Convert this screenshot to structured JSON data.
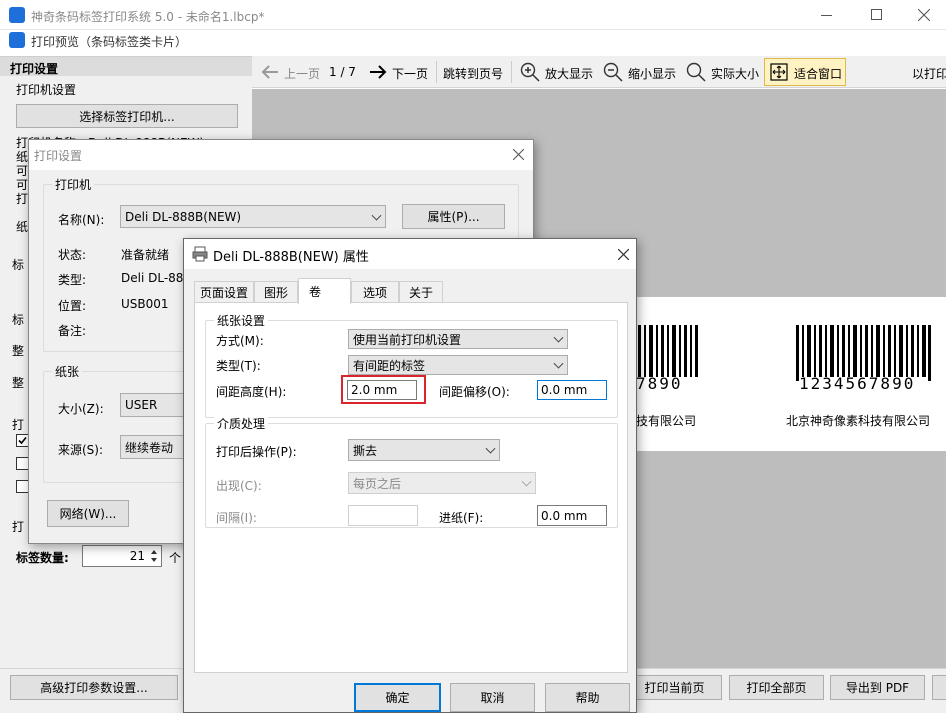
{
  "app": {
    "title": "神奇条码标签打印系统 5.0 - 未命名1.lbcp*"
  },
  "preview_window": {
    "title": "打印预览（条码标签类卡片）"
  },
  "toolbar": {
    "prev_label": "上一页",
    "page_indicator": "1 / 7",
    "next_label": "下一页",
    "jump_label": "跳转到页号",
    "zoom_in_label": "放大显示",
    "zoom_out_label": "缩小显示",
    "actual_size_label": "实际大小",
    "fit_window_label": "适合窗口",
    "overflow_label": "以打印"
  },
  "left_panel": {
    "title": "打印设置",
    "printer_group": "打印机设置",
    "select_printer_button": "选择标签打印机...",
    "printer_name_partial": "打印机名称：Deli DL-888B(NEW)",
    "partial_labels": [
      "纸",
      "可",
      "可",
      "打",
      "纸",
      "标",
      "标",
      "整",
      "整",
      "打",
      "打"
    ],
    "label_count_label": "标签数量:",
    "label_count_value": "21",
    "label_count_unit": "个",
    "advanced_button": "高级打印参数设置..."
  },
  "preview_labels": [
    {
      "digits": "7890",
      "company": "技有限公司"
    },
    {
      "digits": "1234567890",
      "company": "北京神奇像素科技有限公司"
    }
  ],
  "bottom_buttons": {
    "print_current": "打印当前页",
    "print_all": "打印全部页",
    "export_pdf": "导出到 PDF"
  },
  "print_dialog": {
    "title": "打印设置",
    "printer_group": "打印机",
    "name_label": "名称(N):",
    "name_value": "Deli DL-888B(NEW)",
    "properties_button": "属性(P)...",
    "status_label": "状态:",
    "status_value": "准备就绪",
    "type_label": "类型:",
    "type_value": "Deli DL-888B(NEW)",
    "location_label": "位置:",
    "location_value": "USB001",
    "comment_label": "备注:",
    "paper_group": "纸张",
    "size_label": "大小(Z):",
    "size_value": "USER",
    "source_label": "来源(S):",
    "source_value": "继续卷动",
    "network_button": "网络(W)..."
  },
  "props_dialog": {
    "title": "Deli DL-888B(NEW) 属性",
    "tabs": [
      "页面设置",
      "图形",
      "卷",
      "选项",
      "关于"
    ],
    "active_tab": "卷",
    "paper_group": "纸张设置",
    "method_label": "方式(M):",
    "method_value": "使用当前打印机设置",
    "type_label": "类型(T):",
    "type_value": "有间距的标签",
    "gap_height_label": "间距高度(H):",
    "gap_height_value": "2.0 mm",
    "gap_offset_label": "间距偏移(O):",
    "gap_offset_value": "0.0 mm",
    "media_group": "介质处理",
    "post_print_label": "打印后操作(P):",
    "post_print_value": "撕去",
    "occur_label": "出现(C):",
    "occur_value": "每页之后",
    "interval_label": "间隔(I):",
    "interval_value": "",
    "feed_label": "进纸(F):",
    "feed_value": "0.0 mm",
    "ok_button": "确定",
    "cancel_button": "取消",
    "help_button": "帮助"
  },
  "colors": {
    "highlight_red": "#d9262c",
    "app_icon_blue": "#1e6fd9",
    "focus_blue": "#0078d7"
  }
}
